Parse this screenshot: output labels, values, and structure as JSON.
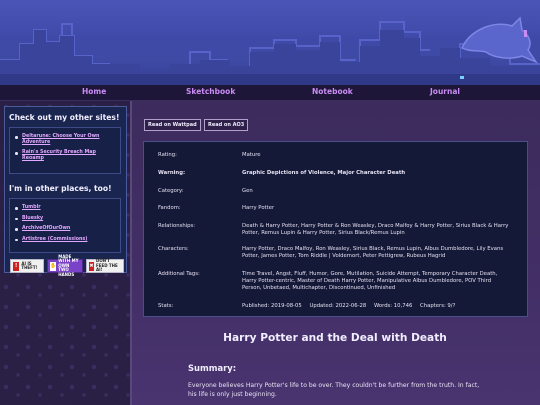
{
  "nav": {
    "items": [
      "Home",
      "Sketchbook",
      "Notebook",
      "Journal"
    ]
  },
  "sidebar": {
    "heading1": "Check out my other sites!",
    "links1": [
      "Deltarune: Choose Your Own Adventure",
      "Rain's Security Breach Map Reoamp"
    ],
    "heading2": "I'm in other places, too!",
    "links2": [
      "Tumblr",
      "Bluesky",
      "ArchiveOfOurOwn",
      "Artistree (Commissions)"
    ],
    "badges": [
      {
        "text": "AI IS THEFT!",
        "icon": "!"
      },
      {
        "text": "MADE WITH MY OWN TWO HANDS",
        "icon": "✋"
      },
      {
        "text": "DON'T FEED THE AI!",
        "icon": "✖"
      }
    ]
  },
  "buttons": {
    "wattpad": "Read on Wattpad",
    "ao3": "Read on AO3"
  },
  "meta": {
    "rating": {
      "label": "Rating:",
      "value": "Mature"
    },
    "warnings": {
      "label": "Warning:",
      "value": "Graphic Depictions of Violence, Major Character Death"
    },
    "category": {
      "label": "Category:",
      "value": "Gen"
    },
    "fandom": {
      "label": "Fandom:",
      "value": "Harry Potter"
    },
    "relationships": {
      "label": "Relationships:",
      "value": "Death & Harry Potter, Harry Potter & Ron Weasley, Draco Malfoy & Harry Potter, Sirius Black & Harry Potter, Remus Lupin & Harry Potter, Sirius Black/Remus Lupin"
    },
    "characters": {
      "label": "Characters:",
      "value": "Harry Potter, Draco Malfoy, Ron Weasley, Sirius Black, Remus Lupin, Albus Dumbledore, Lily Evans Potter, James Potter, Tom Riddle | Voldemort, Peter Pettigrew, Rubeus Hagrid"
    },
    "tags": {
      "label": "Additional Tags:",
      "value": "Time Travel, Angst, Fluff, Humor, Gore, Mutilation, Suicide Attempt, Temporary Character Death, Harry Potter-centric, Master of Death Harry Potter, Manipulative Albus Dumbledore, POV Third Person, Unbetaed, Multichapter, Discontinued, Unfinished"
    },
    "stats": {
      "label": "Stats:",
      "published": "Published: 2019-08-05",
      "updated": "Updated: 2022-06-28",
      "words": "Words: 10,746",
      "chapters": "Chapters: 9/?"
    }
  },
  "story": {
    "title": "Harry Potter and the Deal with Death",
    "summary_heading": "Summary:",
    "summary": "Everyone believes Harry Potter's life to be over. They couldn't be further from the truth. In fact, his life is only just beginning."
  },
  "colors": {
    "accent": "#c98cf4",
    "banner": "#4a55b8",
    "panel": "#151938"
  }
}
